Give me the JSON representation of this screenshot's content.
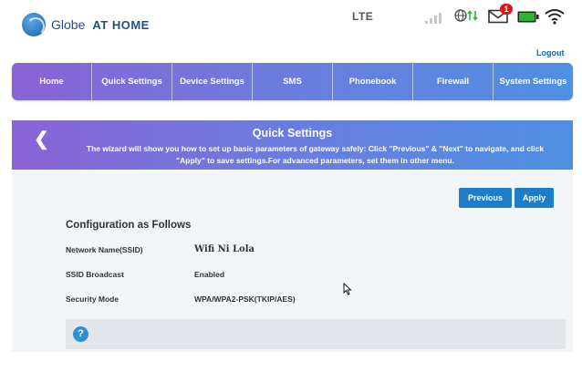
{
  "header": {
    "brand": "Globe",
    "brand_sub": "AT HOME",
    "network_type": "LTE",
    "mail_count": "1",
    "logout_label": "Logout"
  },
  "nav": {
    "items": [
      {
        "label": "Home"
      },
      {
        "label": "Quick Settings"
      },
      {
        "label": "Device Settings"
      },
      {
        "label": "SMS"
      },
      {
        "label": "Phonebook"
      },
      {
        "label": "Firewall"
      },
      {
        "label": "System Settings"
      }
    ]
  },
  "panel": {
    "title": "Quick Settings",
    "description": "The wizard will show you how to set up basic parameters of gateway safely: Click \"Previous\" & \"Next\" to navigate, and click \"Apply\" to save settings.For advanced parameters, set them in other menu.",
    "previous_label": "Previous",
    "apply_label": "Apply",
    "config_heading": "Configuration as Follows",
    "rows": [
      {
        "label": "Network Name(SSID)",
        "value": "Wifi Ni Lola"
      },
      {
        "label": "SSID Broadcast",
        "value": "Enabled"
      },
      {
        "label": "Security Mode",
        "value": "WPA/WPA2-PSK(TKIP/AES)"
      }
    ]
  },
  "icons": {
    "back": "chevron-left-icon",
    "help": "question-icon",
    "signal": "signal-bars-icon",
    "network": "globe-data-icon",
    "mail": "envelope-icon",
    "battery": "battery-icon",
    "wifi": "wifi-icon"
  },
  "colors": {
    "accent_blue": "#1f7cc6",
    "gradient_start": "#8a63d6",
    "gradient_end": "#4e8fe2",
    "badge_red": "#e0141e",
    "battery_green": "#2fb52f"
  }
}
